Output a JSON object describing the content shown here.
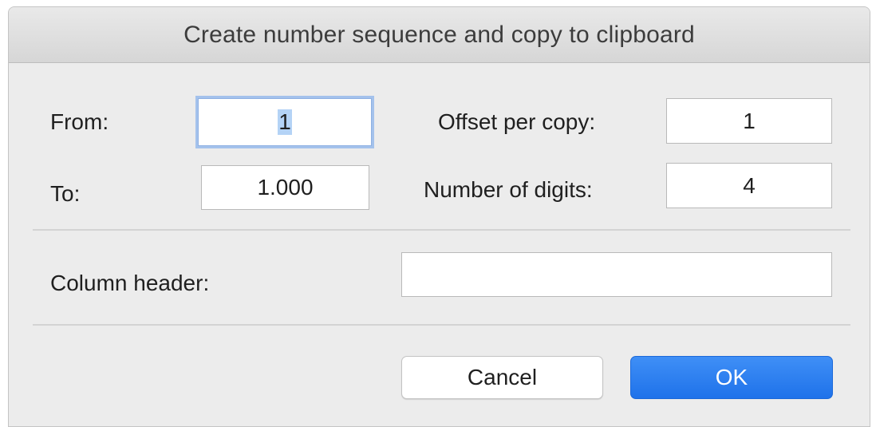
{
  "dialog": {
    "title": "Create number sequence and copy to clipboard"
  },
  "fields": {
    "from": {
      "label": "From:",
      "value": "1"
    },
    "to": {
      "label": "To:",
      "value": "1.000"
    },
    "offset_per_copy": {
      "label": "Offset per copy:",
      "value": "1"
    },
    "number_of_digits": {
      "label": "Number of digits:",
      "value": "4"
    },
    "column_header": {
      "label": "Column header:",
      "value": ""
    }
  },
  "buttons": {
    "cancel_label": "Cancel",
    "ok_label": "OK"
  },
  "colors": {
    "accent": "#1f72ea",
    "focus_ring": "#a4c2ec",
    "selection": "#b4d3f6"
  }
}
